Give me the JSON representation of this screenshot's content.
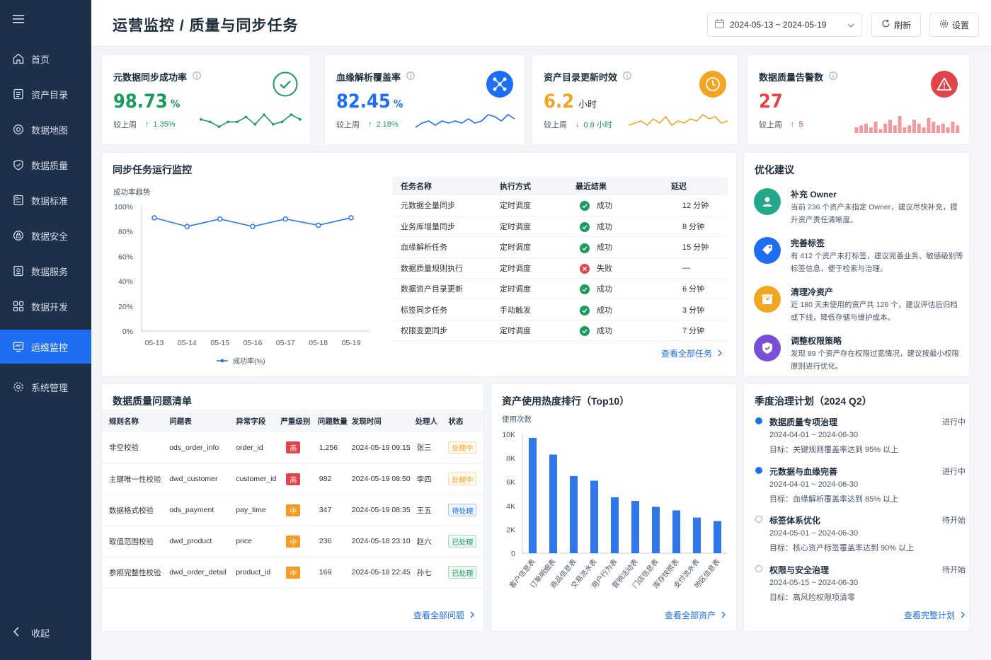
{
  "sidebar": {
    "items": [
      {
        "label": "首页",
        "icon": "home-icon"
      },
      {
        "label": "资产目录",
        "icon": "catalog-icon"
      },
      {
        "label": "数据地图",
        "icon": "map-icon"
      },
      {
        "label": "数据质量",
        "icon": "shield-check-icon"
      },
      {
        "label": "数据标准",
        "icon": "standard-icon"
      },
      {
        "label": "数据安全",
        "icon": "security-icon"
      },
      {
        "label": "数据服务",
        "icon": "service-icon"
      },
      {
        "label": "数据开发",
        "icon": "grid-icon"
      },
      {
        "label": "运维监控",
        "icon": "monitor-icon"
      },
      {
        "label": "系统管理",
        "icon": "gear-icon"
      }
    ],
    "active": "运维监控",
    "collapse_label": "收起"
  },
  "header": {
    "title": "运营监控 / 质量与同步任务",
    "date_range": "2024-05-13 ~ 2024-05-19",
    "refresh_label": "刷新",
    "settings_label": "设置"
  },
  "kpis": [
    {
      "title": "元数据同步成功率",
      "value": "98.73",
      "unit": "%",
      "compare_label": "较上周",
      "delta": "1.35%",
      "direction": "up",
      "color": "#1a9b5e",
      "spark": [
        5,
        4,
        2,
        4,
        4,
        6,
        3,
        7,
        3,
        4,
        7,
        5
      ]
    },
    {
      "title": "血缘解析覆盖率",
      "value": "82.45",
      "unit": "%",
      "compare_label": "较上周",
      "delta": "2.18%",
      "direction": "up",
      "color": "#1d6ef0",
      "spark": [
        2,
        4,
        5,
        3,
        5,
        4,
        5,
        4,
        6,
        4,
        5,
        8,
        7,
        5,
        8,
        6
      ]
    },
    {
      "title": "资产目录更新时效",
      "value": "6.2",
      "unit": "小时",
      "compare_label": "较上周",
      "delta": "0.8 小时",
      "direction": "down",
      "color": "#f2a521",
      "spark": [
        3,
        4,
        5,
        3,
        6,
        4,
        7,
        3,
        5,
        4,
        6,
        5,
        8,
        6,
        7,
        4,
        5
      ]
    },
    {
      "title": "数据质量告警数",
      "value": "27",
      "unit": "",
      "compare_label": "较上周",
      "delta": "5",
      "direction": "up",
      "color": "#e0454b",
      "spark": [
        3,
        4,
        5,
        3,
        6,
        2,
        5,
        7,
        4,
        9,
        3,
        4,
        7,
        5,
        3,
        8,
        6,
        4,
        5,
        3,
        6,
        4
      ]
    }
  ],
  "sync": {
    "title": "同步任务运行监控",
    "chart_label": "成功率趋势",
    "chart_data": {
      "type": "line",
      "x": [
        "05-13",
        "05-14",
        "05-15",
        "05-16",
        "05-17",
        "05-18",
        "05-19"
      ],
      "series": [
        {
          "name": "成功率(%)",
          "values": [
            91,
            84,
            90,
            84,
            90,
            85,
            91
          ]
        }
      ],
      "ylim": [
        0,
        100
      ],
      "yticks": [
        "0%",
        "20%",
        "40%",
        "60%",
        "80%",
        "100%"
      ],
      "grid": false,
      "legend": "bottom"
    },
    "table": {
      "headers": [
        "任务名称",
        "执行方式",
        "最近结果",
        "延迟"
      ],
      "rows": [
        {
          "name": "元数据全量同步",
          "mode": "定时调度",
          "result": "成功",
          "ok": true,
          "delay": "12 分钟"
        },
        {
          "name": "业务库增量同步",
          "mode": "定时调度",
          "result": "成功",
          "ok": true,
          "delay": "8 分钟"
        },
        {
          "name": "血缘解析任务",
          "mode": "定时调度",
          "result": "成功",
          "ok": true,
          "delay": "15 分钟"
        },
        {
          "name": "数据质量规则执行",
          "mode": "定时调度",
          "result": "失败",
          "ok": false,
          "delay": "—"
        },
        {
          "name": "数据资产目录更新",
          "mode": "定时调度",
          "result": "成功",
          "ok": true,
          "delay": "6 分钟"
        },
        {
          "name": "标签同步任务",
          "mode": "手动触发",
          "result": "成功",
          "ok": true,
          "delay": "3 分钟"
        },
        {
          "name": "权限变更同步",
          "mode": "定时调度",
          "result": "成功",
          "ok": true,
          "delay": "7 分钟"
        }
      ]
    },
    "view_all": "查看全部任务"
  },
  "suggestions": {
    "title": "优化建议",
    "items": [
      {
        "title": "补充 Owner",
        "desc": "当前 236 个资产未指定 Owner，建议尽快补充，提升资产责任清晰度。",
        "color": "#25a88a",
        "icon": "user-icon"
      },
      {
        "title": "完善标签",
        "desc": "有 412 个资产未打标签，建议完善业务、敏感级别等标签信息，便于检索与治理。",
        "color": "#1d6ef0",
        "icon": "tag-icon"
      },
      {
        "title": "清理冷资产",
        "desc": "近 180 天未使用的资产共 126 个，建议评估后归档或下线，降低存储与维护成本。",
        "color": "#f2a521",
        "icon": "box-icon"
      },
      {
        "title": "调整权限策略",
        "desc": "发现 89 个资产存在权限过宽情况，建议按最小权限原则进行优化。",
        "color": "#7a4fd6",
        "icon": "shield-icon"
      }
    ]
  },
  "dq": {
    "title": "数据质量问题清单",
    "headers": [
      "规则名称",
      "问题表",
      "异常字段",
      "严重级别",
      "问题数量",
      "发现时间",
      "处理人",
      "状态"
    ],
    "rows": [
      {
        "rule": "非空校验",
        "table": "ods_order_info",
        "field": "order_id",
        "sev": "高",
        "sev_color": "#e0454b",
        "count": "1,256",
        "time": "2024-05-19 09:15",
        "owner": "张三",
        "status": "处理中",
        "status_color": "#f2a521"
      },
      {
        "rule": "主键唯一性校验",
        "table": "dwd_customer",
        "field": "customer_id",
        "sev": "高",
        "sev_color": "#e0454b",
        "count": "982",
        "time": "2024-05-19 08:50",
        "owner": "李四",
        "status": "处理中",
        "status_color": "#f2a521"
      },
      {
        "rule": "数据格式校验",
        "table": "ods_payment",
        "field": "pay_time",
        "sev": "中",
        "sev_color": "#f59a23",
        "count": "347",
        "time": "2024-05-19 08:35",
        "owner": "王五",
        "status": "待处理",
        "status_color": "#1d6ef0"
      },
      {
        "rule": "取值范围校验",
        "table": "dwd_product",
        "field": "price",
        "sev": "中",
        "sev_color": "#f59a23",
        "count": "236",
        "time": "2024-05-18 23:10",
        "owner": "赵六",
        "status": "已处理",
        "status_color": "#1a9b5e"
      },
      {
        "rule": "参照完整性校验",
        "table": "dwd_order_detail",
        "field": "product_id",
        "sev": "中",
        "sev_color": "#f59a23",
        "count": "169",
        "time": "2024-05-18 22:45",
        "owner": "孙七",
        "status": "已处理",
        "status_color": "#1a9b5e"
      }
    ],
    "view_all": "查看全部问题"
  },
  "usage": {
    "title": "资产使用热度排行（Top10）",
    "chart_data": {
      "type": "bar",
      "ylabel": "使用次数",
      "categories": [
        "客户信息表",
        "订单明细表",
        "商品信息表",
        "交易流水表",
        "用户行为表",
        "营销活动表",
        "门店信息表",
        "库存快照表",
        "支付流水表",
        "地区信息表"
      ],
      "values": [
        9700,
        8300,
        6500,
        6100,
        4700,
        4400,
        3900,
        3600,
        3000,
        2700
      ],
      "ylim": [
        0,
        10000
      ],
      "yticks": [
        "0",
        "2K",
        "4K",
        "6K",
        "8K",
        "10K"
      ],
      "grid": false
    },
    "view_all": "查看全部资产"
  },
  "plan": {
    "title": "季度治理计划（2024 Q2）",
    "items": [
      {
        "title": "数据质量专项治理",
        "state": "进行中",
        "active": true,
        "date": "2024-04-01 ~ 2024-06-30",
        "goal": "目标：关键规则覆盖率达到 95% 以上"
      },
      {
        "title": "元数据与血缘完善",
        "state": "进行中",
        "active": true,
        "date": "2024-04-01 ~ 2024-06-30",
        "goal": "目标：血缘解析覆盖率达到 85% 以上"
      },
      {
        "title": "标签体系优化",
        "state": "待开始",
        "active": false,
        "date": "2024-05-01 ~ 2024-06-30",
        "goal": "目标：核心资产标签覆盖率达到 90% 以上"
      },
      {
        "title": "权限与安全治理",
        "state": "待开始",
        "active": false,
        "date": "2024-05-15 ~ 2024-06-30",
        "goal": "目标：高风险权限项清零"
      }
    ],
    "view_all": "查看完整计划"
  }
}
